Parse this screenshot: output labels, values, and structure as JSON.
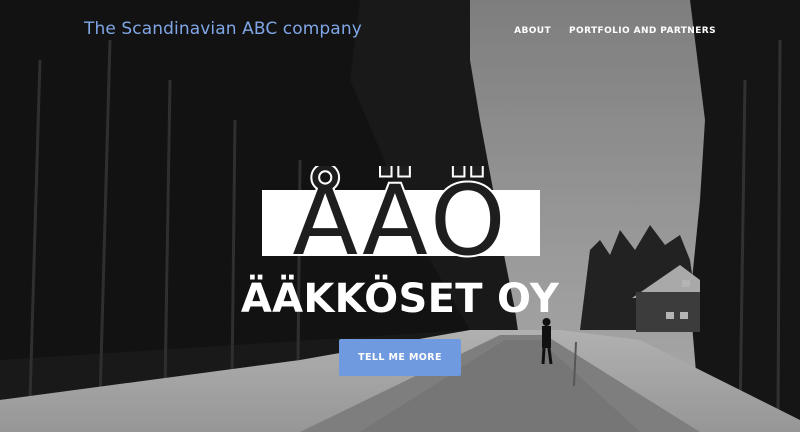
{
  "header": {
    "brand": "The Scandinavian ABC company",
    "nav": [
      {
        "label": "ABOUT"
      },
      {
        "label": "PORTFOLIO AND PARTNERS"
      }
    ]
  },
  "hero": {
    "logo_text": "ÅÄÖ",
    "headline": "ÄÄKKÖSET OY",
    "cta_label": "TELL ME MORE"
  },
  "colors": {
    "accent": "#6f9ae0",
    "brand_text": "#7fa6e6",
    "text": "#ffffff"
  }
}
